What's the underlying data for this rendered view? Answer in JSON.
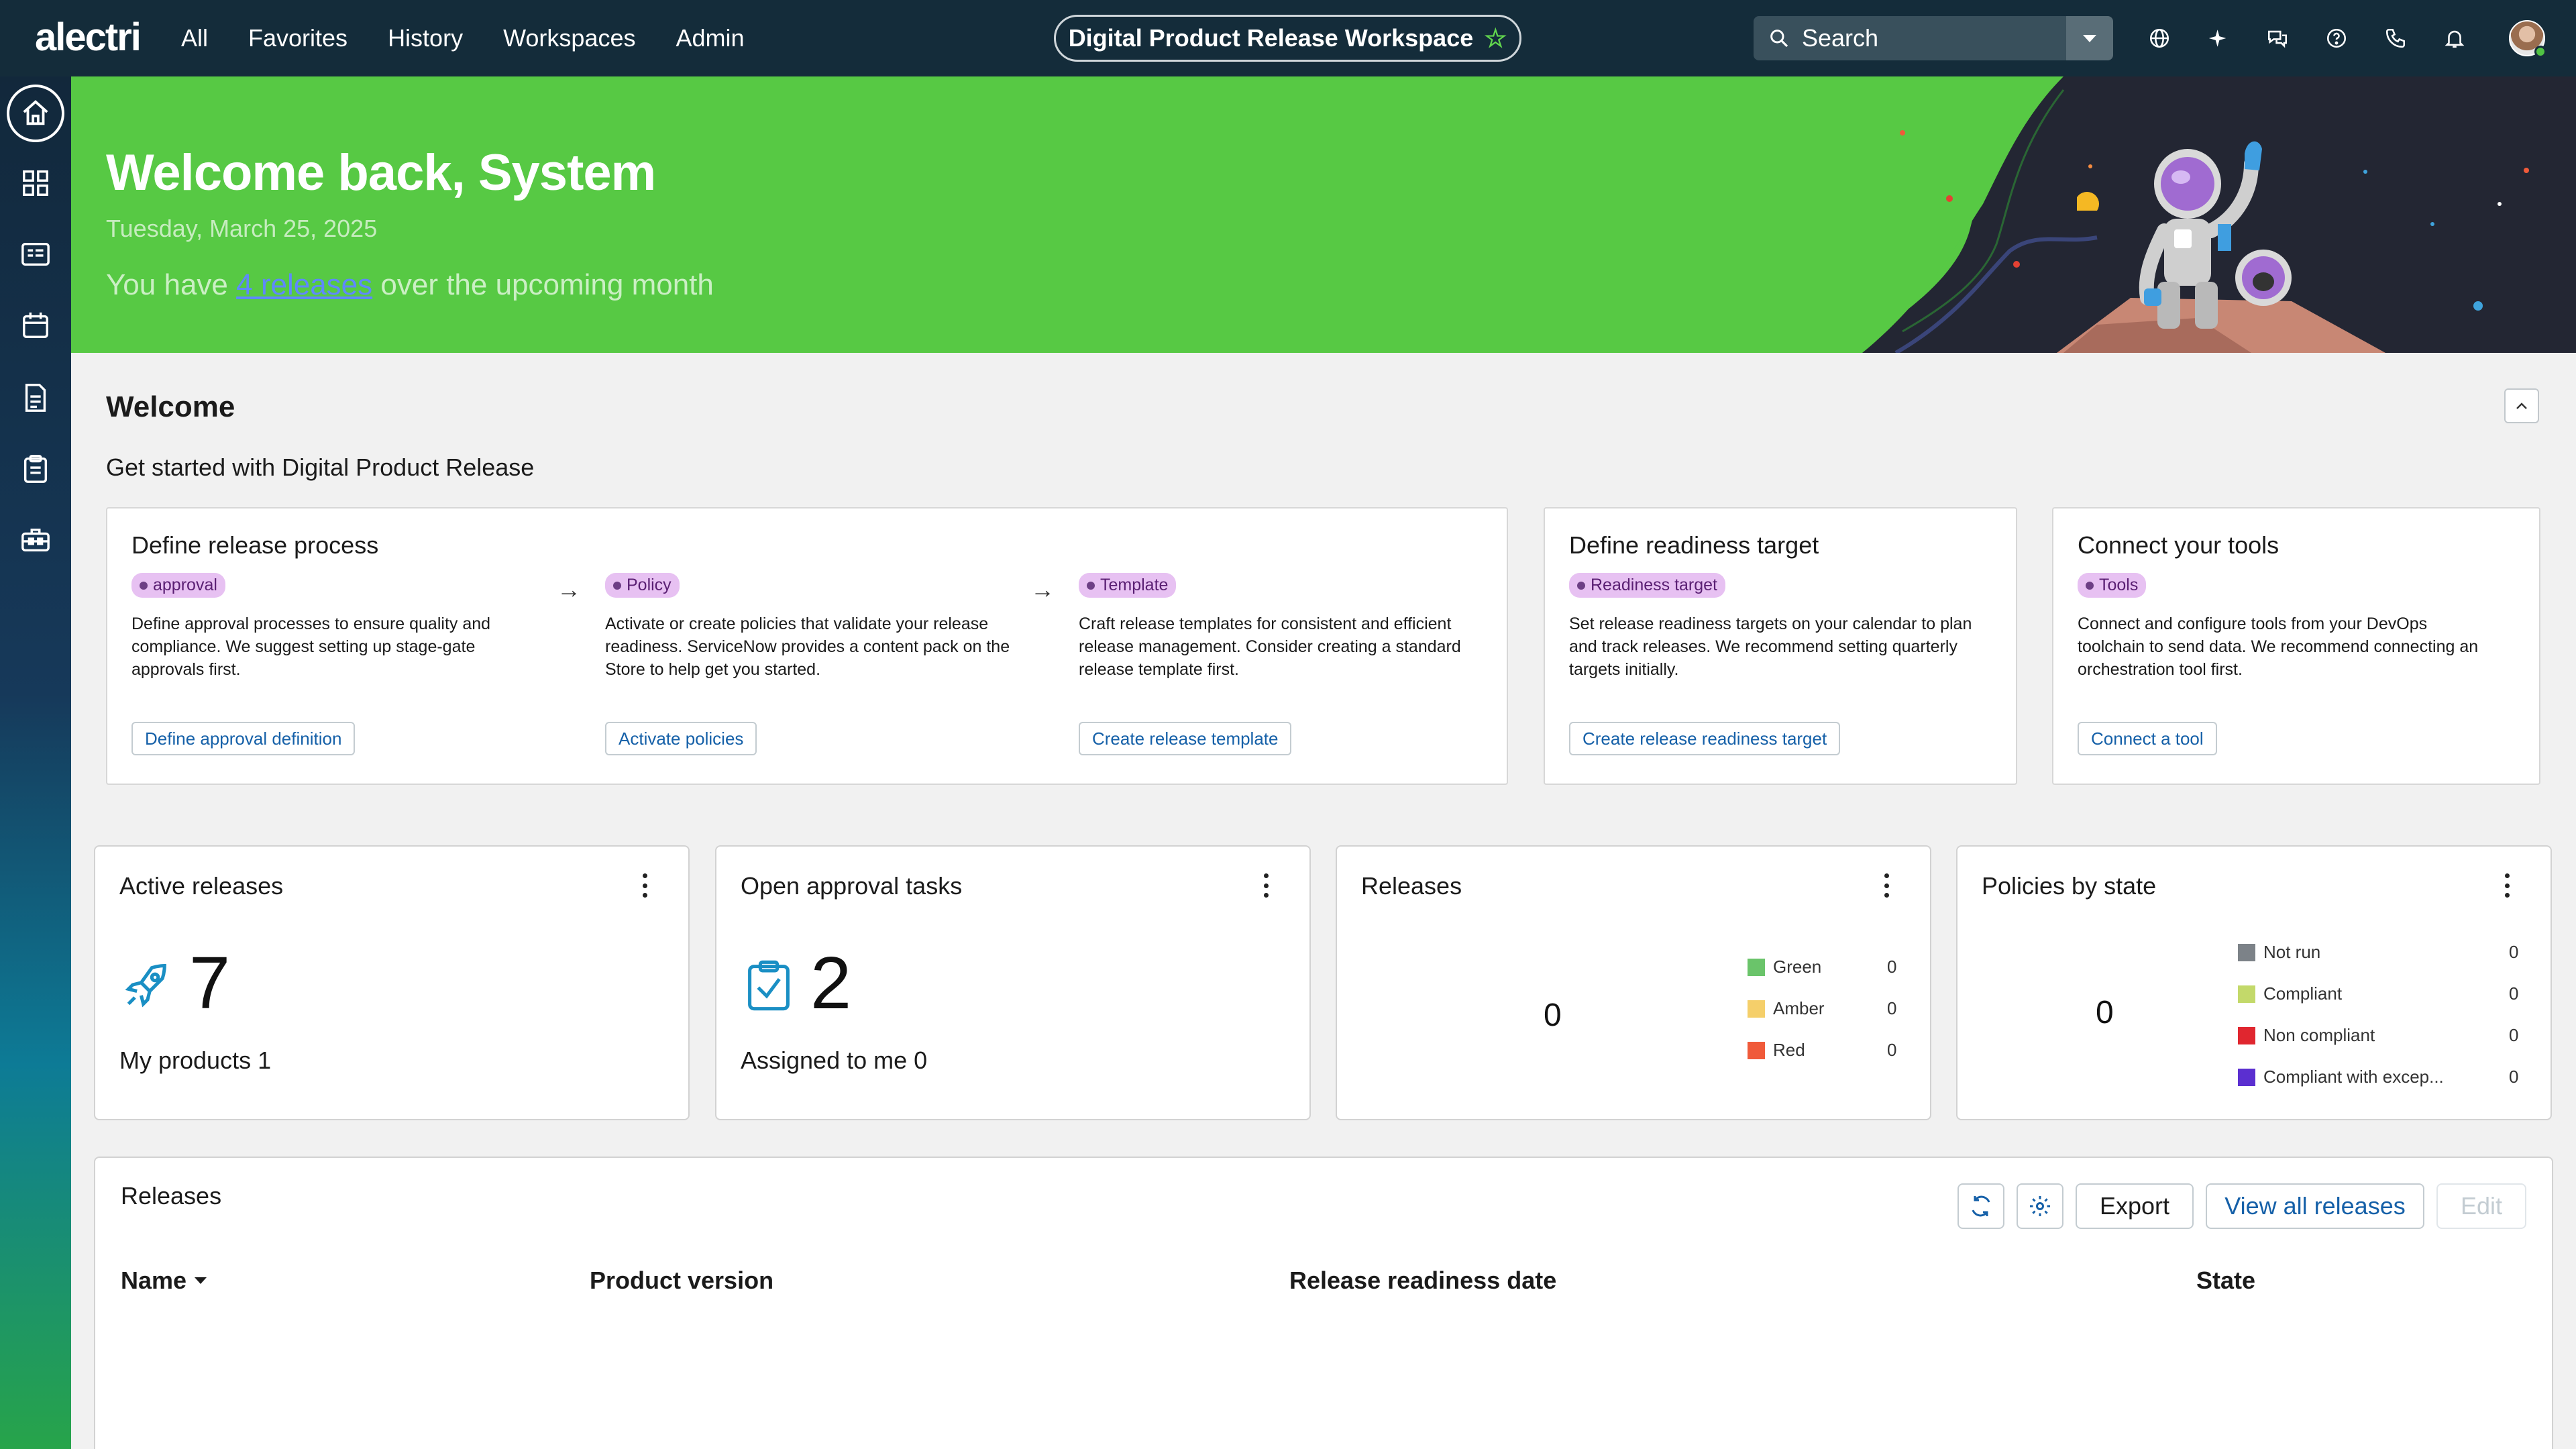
{
  "brand": {
    "logo_text": "alectri"
  },
  "topnav": {
    "items": [
      "All",
      "Favorites",
      "History",
      "Workspaces",
      "Admin"
    ],
    "workspace_title": "Digital Product Release Workspace",
    "search_placeholder": "Search"
  },
  "banner": {
    "greeting": "Welcome back, System",
    "date": "Tuesday, March 25, 2025",
    "releases_prefix": "You have",
    "releases_link": "4 releases",
    "releases_suffix": "over the upcoming month"
  },
  "welcome": {
    "title": "Welcome",
    "subtitle": "Get started with Digital Product Release",
    "cards": {
      "process": {
        "title": "Define release process",
        "steps": [
          {
            "badge": "approval",
            "text": "Define approval processes to ensure quality and compliance. We suggest setting up stage-gate approvals first.",
            "button": "Define approval definition"
          },
          {
            "badge": "Policy",
            "text": "Activate or create policies that validate your release readiness. ServiceNow provides a content pack on the Store to help get you started.",
            "button": "Activate policies"
          },
          {
            "badge": "Template",
            "text": "Craft release templates for consistent and efficient release management. Consider creating a standard release template first.",
            "button": "Create release template"
          }
        ]
      },
      "readiness": {
        "title": "Define readiness target",
        "badge": "Readiness target",
        "text": "Set release readiness targets on your calendar to plan and track releases. We recommend setting quarterly targets initially.",
        "button": "Create release readiness target"
      },
      "tools": {
        "title": "Connect your tools",
        "badge": "Tools",
        "text": "Connect and configure tools from your DevOps toolchain to send data. We recommend connecting an orchestration tool first.",
        "button": "Connect a tool"
      }
    }
  },
  "widgets": {
    "active_releases": {
      "title": "Active releases",
      "value": "7",
      "sub": "My products 1"
    },
    "approval_tasks": {
      "title": "Open approval tasks",
      "value": "2",
      "sub": "Assigned to me 0"
    },
    "releases": {
      "title": "Releases",
      "total": "0",
      "legend": [
        {
          "label": "Green",
          "value": "0",
          "color": "#6ac46a"
        },
        {
          "label": "Amber",
          "value": "0",
          "color": "#f5cf6a"
        },
        {
          "label": "Red",
          "value": "0",
          "color": "#f05a3a"
        }
      ]
    },
    "policies": {
      "title": "Policies by state",
      "total": "0",
      "legend": [
        {
          "label": "Not run",
          "value": "0",
          "color": "#7c8288"
        },
        {
          "label": "Compliant",
          "value": "0",
          "color": "#c3d96a"
        },
        {
          "label": "Non compliant",
          "value": "0",
          "color": "#e0262f"
        },
        {
          "label": "Compliant with excep...",
          "value": "0",
          "color": "#5b2fd0"
        }
      ]
    }
  },
  "releases_table": {
    "title": "Releases",
    "buttons": {
      "export": "Export",
      "view_all": "View all releases",
      "edit": "Edit"
    },
    "columns": [
      "Name",
      "Product version",
      "Release readiness date",
      "State"
    ]
  }
}
